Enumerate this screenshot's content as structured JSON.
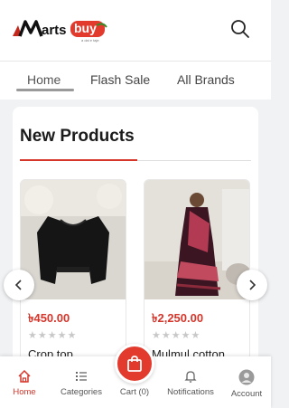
{
  "header": {
    "logo_text_left": "arts",
    "logo_text_right": "buy",
    "logo_tagline": "a dal e taje"
  },
  "nav": {
    "tabs": [
      {
        "label": "Home"
      },
      {
        "label": "Flash Sale"
      },
      {
        "label": "All Brands"
      }
    ]
  },
  "section": {
    "title": "New Products"
  },
  "products": [
    {
      "price": "৳450.00",
      "rating_stars": "★★★★★",
      "name": "Crop top"
    },
    {
      "price": "৳2,250.00",
      "rating_stars": "★★★★★",
      "name": "Mulmul cotton"
    }
  ],
  "bottom_nav": {
    "items": [
      {
        "label": "Home"
      },
      {
        "label": "Categories"
      },
      {
        "label": "Cart (0)"
      },
      {
        "label": "Notifications"
      },
      {
        "label": "Account"
      }
    ]
  },
  "colors": {
    "accent": "#d6352a",
    "cart_button": "#e23a2c"
  }
}
